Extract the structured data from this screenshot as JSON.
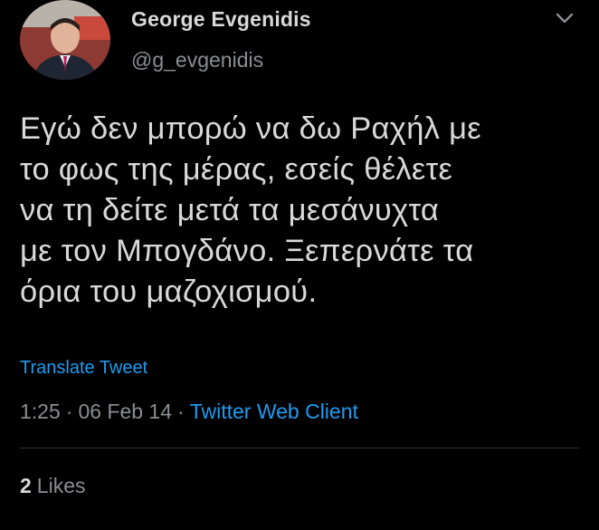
{
  "user": {
    "display_name": "George Evgenidis",
    "handle": "@g_evgenidis",
    "avatar_icon": "profile-photo"
  },
  "tweet": {
    "text": "Εγώ δεν μπορώ να δω Ραχήλ με\nτο φως της μέρας, εσείς θέλετε\nνα τη δείτε μετά τα μεσάνυχτα\nμε τον Μπογδάνο. Ξεπερνάτε τα\nόρια του μαζοχισμού.",
    "translate_label": "Translate Tweet",
    "time": "1:25",
    "date": "06 Feb 14",
    "separator": "·",
    "client": "Twitter Web Client",
    "likes_count": "2",
    "likes_label": "Likes"
  },
  "colors": {
    "background": "#000000",
    "text": "#d9d9d9",
    "muted": "#8a8d91",
    "link": "#1d9bf0"
  },
  "icons": {
    "menu": "chevron-down-icon"
  }
}
